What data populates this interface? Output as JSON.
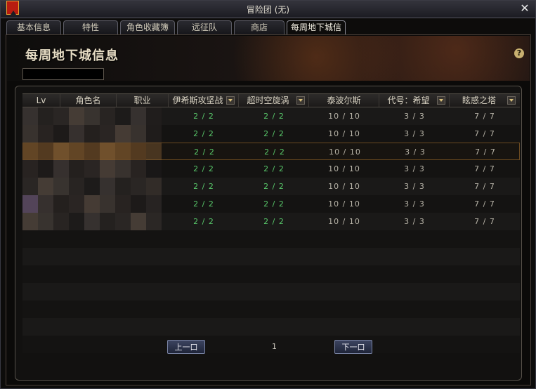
{
  "window": {
    "title": "冒险团 (无)"
  },
  "tabs": [
    {
      "label": "基本信息"
    },
    {
      "label": "特性"
    },
    {
      "label": "角色收藏簿"
    },
    {
      "label": "远征队"
    },
    {
      "label": "商店"
    },
    {
      "label": "每周地下城信息",
      "active": true
    }
  ],
  "banner": {
    "title": "每周地下城信息"
  },
  "table": {
    "columns": [
      "Lv",
      "角色名",
      "职业",
      "伊希斯攻坚战",
      "超时空旋涡",
      "泰波尔斯",
      "代号：希望",
      "眩惑之塔"
    ],
    "rows": [
      [
        "2 / 2",
        "2 / 2",
        "10 / 10",
        "3 / 3",
        "7 / 7"
      ],
      [
        "2 / 2",
        "2 / 2",
        "10 / 10",
        "3 / 3",
        "7 / 7"
      ],
      [
        "2 / 2",
        "2 / 2",
        "10 / 10",
        "3 / 3",
        "7 / 7"
      ],
      [
        "2 / 2",
        "2 / 2",
        "10 / 10",
        "3 / 3",
        "7 / 7"
      ],
      [
        "2 / 2",
        "2 / 2",
        "10 / 10",
        "3 / 3",
        "7 / 7"
      ],
      [
        "2 / 2",
        "2 / 2",
        "10 / 10",
        "3 / 3",
        "7 / 7"
      ],
      [
        "2 / 2",
        "2 / 2",
        "10 / 10",
        "3 / 3",
        "7 / 7"
      ]
    ],
    "empty_rows": 7,
    "selected_row": 2
  },
  "pager": {
    "prev_label": "上一口",
    "next_label": "下一口",
    "page": "1"
  },
  "colors": {
    "green": "#58c86a",
    "accent": "#d8c07a"
  },
  "icons": {
    "flag": "flag-icon",
    "close": "close-icon",
    "help": "help-icon",
    "dropdown": "chevron-down-icon"
  }
}
